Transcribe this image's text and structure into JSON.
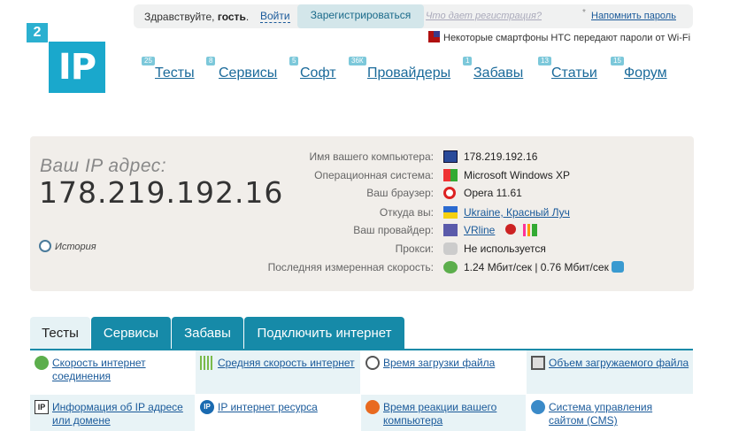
{
  "topbar": {
    "greeting_prefix": "Здравствуйте,",
    "greeting_name": "гость",
    "greeting_suffix": ".",
    "login": "Войти",
    "register": "Зарегистрироваться",
    "what_register": "Что дает регистрация?",
    "remind_password": "Напомнить пароль",
    "news": "Некоторые смартфоны HTC передают пароли от Wi-Fi"
  },
  "logo": {
    "two": "2",
    "ip": "IP"
  },
  "nav": [
    {
      "badge": "25",
      "label": "Тесты"
    },
    {
      "badge": "8",
      "label": "Сервисы"
    },
    {
      "badge": "5",
      "label": "Софт"
    },
    {
      "badge": "36К",
      "label": "Провайдеры"
    },
    {
      "badge": "1",
      "label": "Забавы"
    },
    {
      "badge": "13",
      "label": "Статьи"
    },
    {
      "badge": "15",
      "label": "Форум"
    }
  ],
  "ip_panel": {
    "label": "Ваш IP адрес:",
    "value": "178.219.192.16",
    "history": "История",
    "rows": [
      {
        "key": "Имя вашего компьютера:",
        "icon": "computer-icon",
        "value": "178.219.192.16"
      },
      {
        "key": "Операционная система:",
        "icon": "windows-icon",
        "value": "Microsoft Windows XP"
      },
      {
        "key": "Ваш браузер:",
        "icon": "opera-icon",
        "value": "Opera 11.61"
      },
      {
        "key": "Откуда вы:",
        "icon": "ukraine-flag-icon",
        "value": "Ukraine, Красный Луч"
      },
      {
        "key": "Ваш провайдер:",
        "icon": "provider-icon",
        "value": "VRline"
      },
      {
        "key": "Прокси:",
        "icon": "proxy-icon",
        "value": "Не используется"
      },
      {
        "key": "Последняя измеренная скорость:",
        "icon": "speed-icon",
        "value": "1.24 Мбит/сек | 0.76 Мбит/сек"
      }
    ]
  },
  "tabs": [
    "Тесты",
    "Сервисы",
    "Забавы",
    "Подключить интернет"
  ],
  "tests": [
    {
      "icon": "speed-arrow-icon",
      "label": "Скорость интернет соединения"
    },
    {
      "icon": "bars-icon",
      "label": "Средняя скорость интернет"
    },
    {
      "icon": "clock-icon",
      "label": "Время загрузки файла"
    },
    {
      "icon": "box-icon",
      "label": "Объем загружаемого файла"
    },
    {
      "icon": "ip-info-icon",
      "label": "Информация об IP адресе или домене"
    },
    {
      "icon": "ip-resource-icon",
      "label": "IP интернет ресурса"
    },
    {
      "icon": "reaction-icon",
      "label": "Время реакции вашего компьютера"
    },
    {
      "icon": "cms-icon",
      "label": "Система управления сайтом (CMS)"
    }
  ],
  "colors": {
    "accent": "#168aa8",
    "panel": "#f1eeea",
    "link": "#1a5a9a"
  }
}
